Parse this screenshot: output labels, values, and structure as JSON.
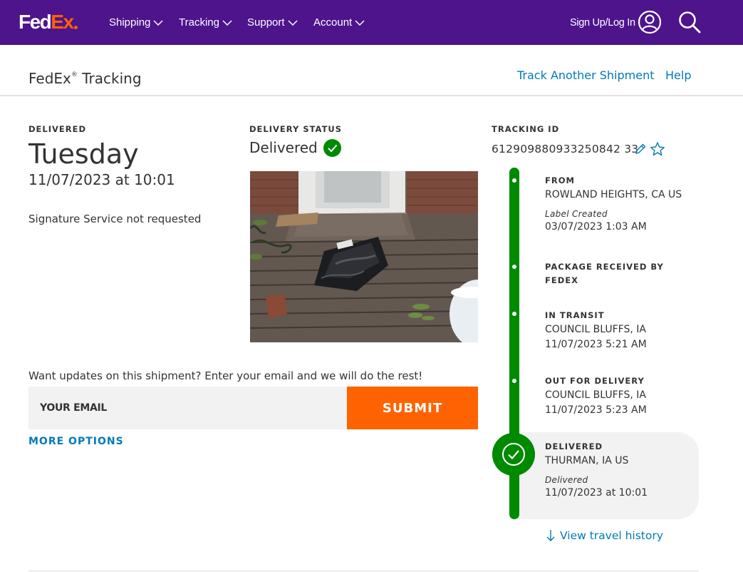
{
  "brand": {
    "logo_fed": "Fed",
    "logo_ex": "Ex",
    "purple": "#4d148c",
    "orange": "#ff6200",
    "green": "#008a00",
    "link_blue": "#007ab7"
  },
  "nav": {
    "items": [
      {
        "label": "Shipping"
      },
      {
        "label": "Tracking"
      },
      {
        "label": "Support"
      },
      {
        "label": "Account"
      }
    ],
    "signin": "Sign Up/Log In",
    "icons": [
      "user-icon",
      "search-icon"
    ]
  },
  "subheader": {
    "title": "FedEx",
    "title_mark": "®",
    "title_suffix": " Tracking",
    "track_another": "Track Another Shipment",
    "help": "Help"
  },
  "delivery": {
    "label": "DELIVERED",
    "day": "Tuesday",
    "datetime": "11/07/2023 at 10:01",
    "signature": "Signature Service not requested"
  },
  "status": {
    "label": "DELIVERY STATUS",
    "value": "Delivered"
  },
  "email": {
    "prompt": "Want updates on this shipment? Enter your email and we will do the rest!",
    "placeholder": "YOUR EMAIL",
    "submit": "SUBMIT",
    "more_options": "MORE OPTIONS"
  },
  "tracking": {
    "label": "TRACKING ID",
    "id": "612909880933250842 33"
  },
  "timeline": {
    "steps": [
      {
        "label": "FROM",
        "location": "ROWLAND HEIGHTS, CA US",
        "sub": "Label Created",
        "time": "03/07/2023 1:03 AM"
      },
      {
        "label_line1": "PACKAGE RECEIVED BY",
        "label_line2": "FEDEX"
      },
      {
        "label": "IN TRANSIT",
        "location": "COUNCIL BLUFFS, IA",
        "time": "11/07/2023 5:21 AM"
      },
      {
        "label": "OUT FOR DELIVERY",
        "location": "COUNCIL BLUFFS, IA",
        "time": "11/07/2023 5:23 AM"
      },
      {
        "label": "DELIVERED",
        "location": "THURMAN, IA US",
        "sub": "Delivered",
        "time": "11/07/2023 at 10:01"
      }
    ],
    "view_history": "View travel history"
  }
}
